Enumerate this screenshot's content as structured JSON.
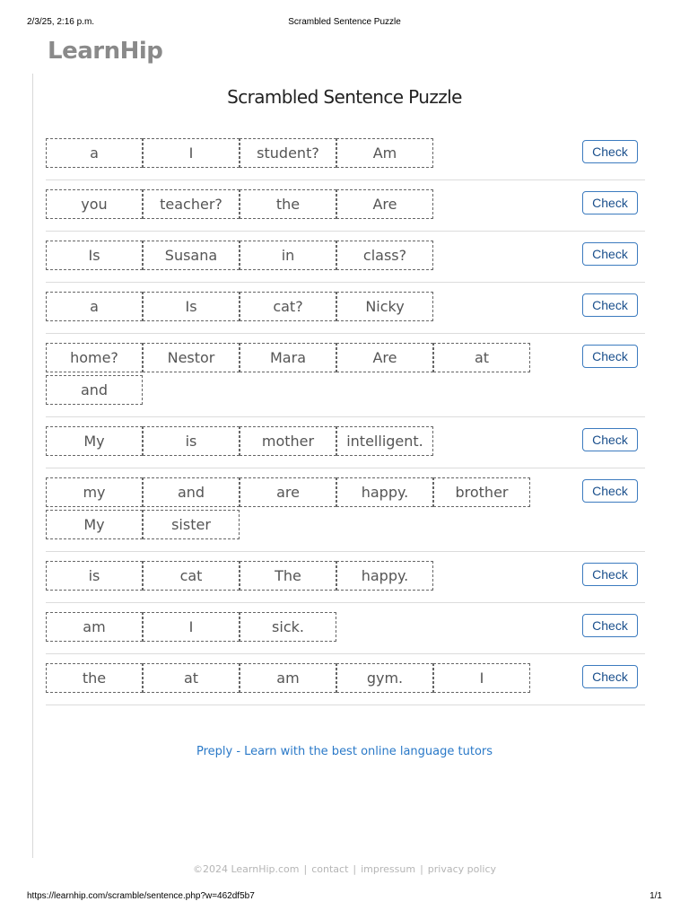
{
  "print_header": {
    "datetime": "2/3/25, 2:16 p.m.",
    "title": "Scrambled Sentence Puzzle"
  },
  "logo": "LearnHip",
  "page_title": "Scrambled Sentence Puzzle",
  "check_label": "Check",
  "puzzles": [
    {
      "words": [
        "a",
        "I",
        "student?",
        "Am"
      ]
    },
    {
      "words": [
        "you",
        "teacher?",
        "the",
        "Are"
      ]
    },
    {
      "words": [
        "Is",
        "Susana",
        "in",
        "class?"
      ]
    },
    {
      "words": [
        "a",
        "Is",
        "cat?",
        "Nicky"
      ]
    },
    {
      "words": [
        "home?",
        "Nestor",
        "Mara",
        "Are",
        "at",
        "and"
      ]
    },
    {
      "words": [
        "My",
        "is",
        "mother",
        "intelligent."
      ]
    },
    {
      "words": [
        "my",
        "and",
        "are",
        "happy.",
        "brother",
        "My",
        "sister"
      ]
    },
    {
      "words": [
        "is",
        "cat",
        "The",
        "happy."
      ]
    },
    {
      "words": [
        "am",
        "I",
        "sick."
      ]
    },
    {
      "words": [
        "the",
        "at",
        "am",
        "gym.",
        "I"
      ]
    }
  ],
  "promo_link": "Preply - Learn with the best online language tutors",
  "footer": {
    "copyright": "©2024 LearnHip.com",
    "contact": "contact",
    "impressum": "impressum",
    "privacy": "privacy policy",
    "separator": "|"
  },
  "print_footer": {
    "url": "https://learnhip.com/scramble/sentence.php?w=462df5b7",
    "page": "1/1"
  }
}
